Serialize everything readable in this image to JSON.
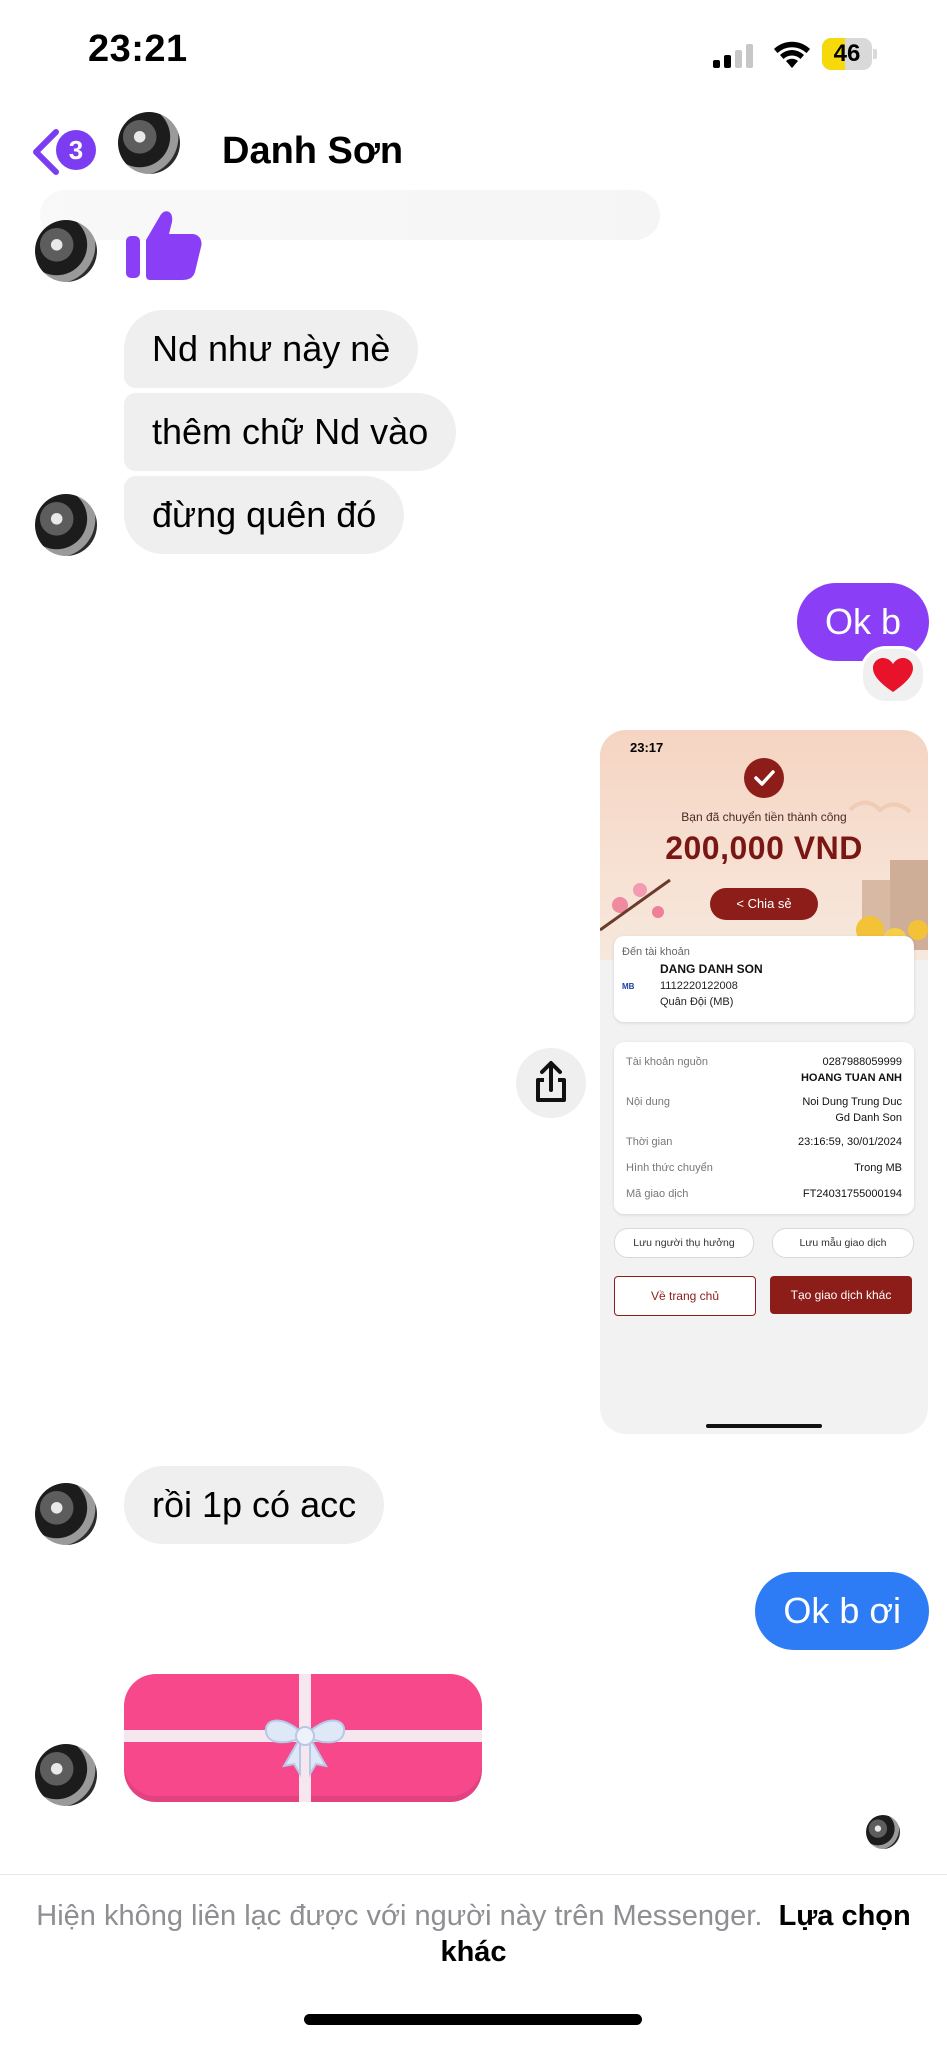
{
  "status_bar": {
    "time": "23:21",
    "battery_level": "46",
    "battery_fraction": 0.46,
    "signal_bars_active": 2,
    "signal_bars_total": 4
  },
  "header": {
    "back_badge_count": "3",
    "contact_name": "Danh Sơn",
    "accent_color": "#7b3cf2"
  },
  "messages": {
    "in_1": "Nd như này nè",
    "in_2": "thêm chữ Nd vào",
    "in_3": "đừng quên đó",
    "out_1": "Ok b",
    "out_1_reaction": "❤️",
    "in_4": "rồi 1p có acc",
    "out_2": "Ok b ơi"
  },
  "receipt": {
    "time": "23:17",
    "success_message": "Bạn đã chuyển tiền thành công",
    "amount": "200,000 VND",
    "share_label": "Chia sẻ",
    "to_account_label": "Đến tài khoản",
    "bank_logo": "MB",
    "recipient_name": "DANG DANH SON",
    "recipient_account": "1112220122008",
    "recipient_bank": "Quân Đội (MB)",
    "rows": [
      {
        "label": "Tài khoản nguồn",
        "value": "0287988059999",
        "value2": "HOANG TUAN ANH"
      },
      {
        "label": "Nội dung",
        "value": "Noi Dung Trung Duc",
        "value2": "Gd Danh Son"
      },
      {
        "label": "Thời gian",
        "value": "23:16:59, 30/01/2024"
      },
      {
        "label": "Hình thức chuyển",
        "value": "Trong MB"
      },
      {
        "label": "Mã giao dịch",
        "value": "FT24031755000194"
      }
    ],
    "save_beneficiary": "Lưu người thụ hưởng",
    "save_template": "Lưu mẫu giao dịch",
    "home_button": "Về trang chủ",
    "new_transaction_button": "Tạo giao dịch khác",
    "brand_color": "#8c1d18"
  },
  "footer": {
    "notice": "Hiện không liên lạc được với người này trên Messenger.",
    "link": "Lựa chọn khác"
  }
}
